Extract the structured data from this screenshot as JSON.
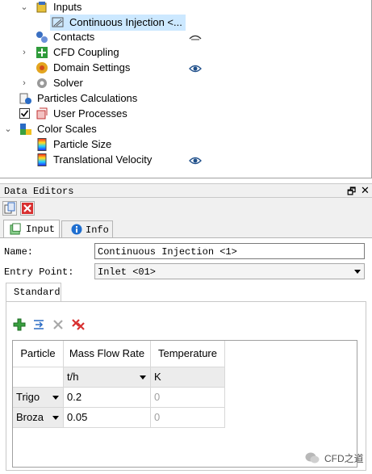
{
  "tree": {
    "items": [
      {
        "label": "Inputs",
        "icon": "inputs-icon"
      },
      {
        "label": "Continuous Injection <...",
        "icon": "injection-icon",
        "selected": true
      },
      {
        "label": "Contacts",
        "icon": "contacts-icon",
        "eye": "eye-closed"
      },
      {
        "label": "CFD Coupling",
        "icon": "cfd-coupling-icon"
      },
      {
        "label": "Domain Settings",
        "icon": "domain-settings-icon",
        "eye": "eye-open"
      },
      {
        "label": "Solver",
        "icon": "solver-icon"
      },
      {
        "label": "Particles Calculations",
        "icon": "particles-calc-icon"
      },
      {
        "label": "User Processes",
        "icon": "user-processes-icon",
        "checked": true
      },
      {
        "label": "Color Scales",
        "icon": "color-scales-icon"
      },
      {
        "label": "Particle Size",
        "icon": "gradient-icon"
      },
      {
        "label": "Translational Velocity",
        "icon": "gradient-icon",
        "eye": "eye-open"
      }
    ]
  },
  "data_editors": {
    "title": "Data Editors",
    "float_glyph": "🗗",
    "close_glyph": "✕",
    "tabs": [
      {
        "label": "Input",
        "icon": "input-tab-icon"
      },
      {
        "label": "Info",
        "icon": "info-icon"
      }
    ],
    "name_label": "Name:",
    "name_value": "Continuous Injection <1>",
    "entry_label": "Entry Point:",
    "entry_value": "Inlet <01>",
    "sub_tab": "Standard",
    "grid": {
      "headers": [
        "Particle",
        "Mass Flow Rate",
        "Temperature"
      ],
      "units": {
        "mass_flow": "t/h",
        "temperature": "K"
      },
      "rows": [
        {
          "particle": "Trigo",
          "mass_flow": "0.2",
          "temperature": "0"
        },
        {
          "particle": "Broza",
          "mass_flow": "0.05",
          "temperature": "0"
        }
      ]
    }
  },
  "watermark": {
    "text": "CFD之道"
  }
}
